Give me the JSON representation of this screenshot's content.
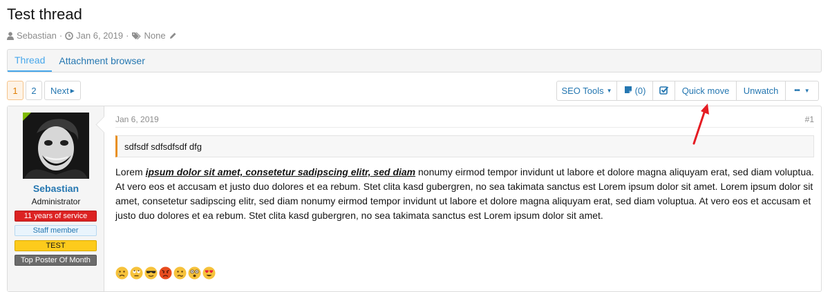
{
  "thread": {
    "title": "Test thread",
    "author": "Sebastian",
    "date": "Jan 6, 2019",
    "tags": "None"
  },
  "tabs": [
    {
      "label": "Thread",
      "active": true
    },
    {
      "label": "Attachment browser",
      "active": false
    }
  ],
  "pagination": {
    "pages": [
      "1",
      "2"
    ],
    "current": "1",
    "next_label": "Next"
  },
  "actions": {
    "seo_tools": "SEO Tools",
    "bookmark_count": "(0)",
    "quick_move": "Quick move",
    "unwatch": "Unwatch",
    "more": "•••"
  },
  "post": {
    "author": "Sebastian",
    "user_title": "Administrator",
    "banners": [
      "11 years of service",
      "Staff member",
      "TEST",
      "Top Poster Of Month"
    ],
    "date": "Jan 6, 2019",
    "number": "#1",
    "quote": "sdfsdf sdfsdfsdf dfg",
    "body_lead": "Lorem ",
    "body_emphasis": "ipsum dolor sit amet, consetetur sadipscing elitr, sed diam",
    "body_rest": " nonumy eirmod tempor invidunt ut labore et dolore magna aliquyam erat, sed diam voluptua. At vero eos et accusam et justo duo dolores et ea rebum. Stet clita kasd gubergren, no sea takimata sanctus est Lorem ipsum dolor sit amet. Lorem ipsum dolor sit amet, consetetur sadipscing elitr, sed diam nonumy eirmod tempor invidunt ut labore et dolore magna aliquyam erat, sed diam voluptua. At vero eos et accusam et justo duo dolores et ea rebum. Stet clita kasd gubergren, no sea takimata sanctus est Lorem ipsum dolor sit amet.",
    "emojis": [
      "crying-face",
      "eye-roll-face",
      "sunglasses-face",
      "angry-face",
      "confused-face",
      "dizzy-face",
      "heart-eyes-face"
    ]
  },
  "colors": {
    "link": "#2577b1",
    "active_tab": "#47a7eb",
    "current_page": "#e07c00",
    "online": "#7fb900",
    "annotation_arrow": "#e51c23"
  }
}
